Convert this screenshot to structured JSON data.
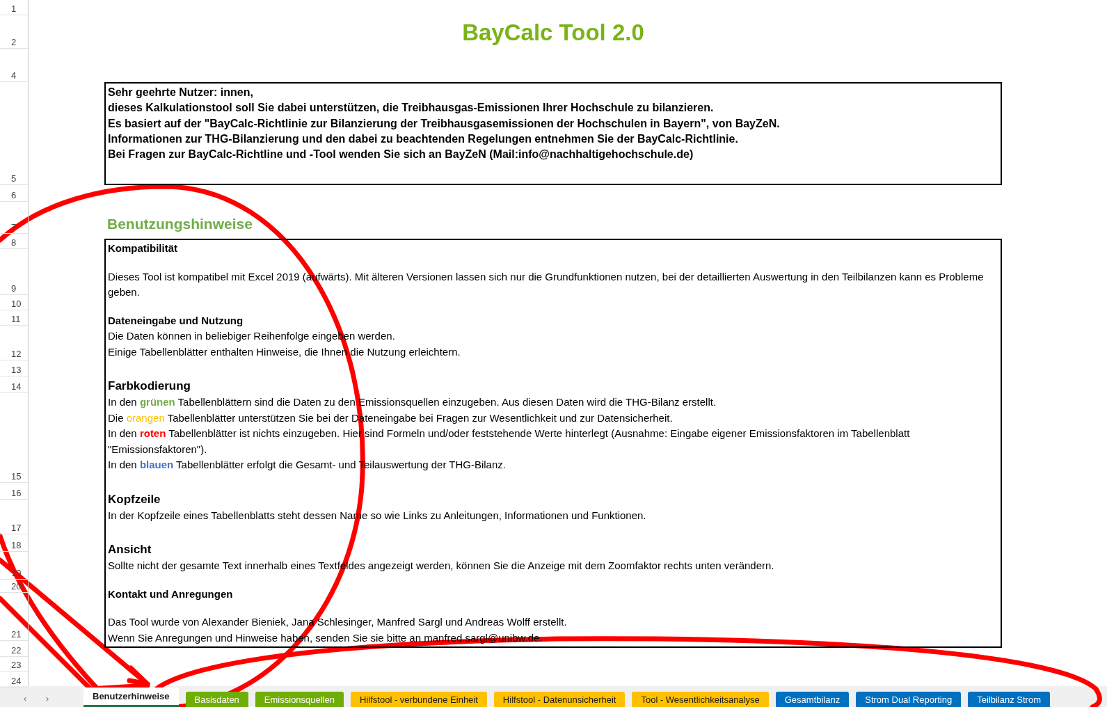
{
  "row_headers": [
    "1",
    "2",
    "4",
    "5",
    "6",
    "7",
    "8",
    "9",
    "10",
    "11",
    "12",
    "13",
    "14",
    "15",
    "16",
    "17",
    "18",
    "19",
    "20",
    "21",
    "22",
    "23",
    "24"
  ],
  "title": "BayCalc Tool 2.0",
  "intro": [
    "Sehr geehrte Nutzer: innen,",
    "dieses Kalkulationstool soll Sie dabei unterstützen, die Treibhausgas-Emissionen Ihrer Hochschule zu bilanzieren.",
    "Es basiert auf der \"BayCalc-Richtlinie zur Bilanzierung der Treibhausgasemissionen der Hochschulen in Bayern\", von BayZeN.",
    "Informationen zur THG-Bilanzierung und den dabei zu beachtenden Regelungen entnehmen Sie der BayCalc-Richtlinie.",
    "Bei Fragen zur BayCalc-Richtline und -Tool wenden Sie sich an BayZeN (Mail:info@nachhaltigehochschule.de)"
  ],
  "section_heading": "Benutzungshinweise",
  "notes": [
    {
      "kind": "heading",
      "text": "Kompatibilität"
    },
    {
      "kind": "blank"
    },
    {
      "kind": "text",
      "text": "Dieses Tool ist kompatibel mit Excel 2019 (aufwärts). Mit älteren Versionen lassen sich nur die Grundfunktionen nutzen, bei der detaillierten Auswertung in den Teilbilanzen kann es Probleme geben."
    },
    {
      "kind": "blank"
    },
    {
      "kind": "heading",
      "text": "Dateneingabe und Nutzung"
    },
    {
      "kind": "text",
      "text": "Die Daten können in beliebiger Reihenfolge eingeben werden."
    },
    {
      "kind": "text",
      "text": "Einige Tabellenblätter enthalten Hinweise, die Ihnen die Nutzung erleichtern."
    },
    {
      "kind": "blank"
    },
    {
      "kind": "large-heading",
      "text": "Farbkodierung"
    },
    {
      "kind": "colored",
      "before": "In den ",
      "word": "grünen",
      "after": " Tabellenblättern sind die Daten zu den Emissionsquellen einzugeben. Aus diesen Daten wird die THG-Bilanz erstellt.",
      "color": "#70ad47",
      "bold": true
    },
    {
      "kind": "colored",
      "before": "Die ",
      "word": "orangen",
      "after": " Tabellenblätter unterstützen Sie bei der Dateneingabe bei Fragen zur Wesentlichkeit und zur Datensicherheit.",
      "color": "#ffc000",
      "bold": false
    },
    {
      "kind": "colored",
      "before": "In den ",
      "word": "roten",
      "after": " Tabellenblätter ist nichts einzugeben. Hier sind Formeln und/oder feststehende Werte hinterlegt (Ausnahme: Eingabe eigener Emissionsfaktoren im Tabellenblatt \"Emissionsfaktoren\").",
      "color": "#ff0000",
      "bold": true
    },
    {
      "kind": "colored",
      "before": "In den ",
      "word": "blauen",
      "after": " Tabellenblätter erfolgt die Gesamt- und Teilauswertung der THG-Bilanz.",
      "color": "#4472c4",
      "bold": true
    },
    {
      "kind": "blank"
    },
    {
      "kind": "large-heading",
      "text": "Kopfzeile"
    },
    {
      "kind": "text",
      "text": "In der Kopfzeile eines Tabellenblatts steht dessen Name so wie Links zu Anleitungen, Informationen und Funktionen."
    },
    {
      "kind": "blank"
    },
    {
      "kind": "large-heading",
      "text": "Ansicht"
    },
    {
      "kind": "text",
      "text": "Sollte nicht der gesamte Text innerhalb eines Textfeldes angezeigt werden, können Sie die Anzeige mit dem Zoomfaktor rechts unten verändern."
    },
    {
      "kind": "blank"
    },
    {
      "kind": "heading",
      "text": "Kontakt und Anregungen"
    },
    {
      "kind": "blank"
    },
    {
      "kind": "text",
      "text": "Das Tool wurde von Alexander Bieniek, Jana Schlesinger, Manfred Sargl und Andreas Wolff erstellt."
    },
    {
      "kind": "text",
      "text": "Wenn Sie Anregungen und Hinweise haben, senden Sie sie bitte an manfred.sargl@unibw.de."
    }
  ],
  "sheet_nav": [
    "‹",
    "›"
  ],
  "sheet_tabs": [
    {
      "label": "Benutzerhinweise",
      "selected": true,
      "color": "#ffffff"
    },
    {
      "label": "Basisdaten",
      "selected": false,
      "color": "#70ad07"
    },
    {
      "label": "Emissionsquellen",
      "selected": false,
      "color": "#70ad07"
    },
    {
      "label": "Hilfstool - verbundene Einheit",
      "selected": false,
      "color": "#ffc000"
    },
    {
      "label": "Hilfstool - Datenunsicherheit",
      "selected": false,
      "color": "#ffc000"
    },
    {
      "label": "Tool - Wesentlichkeitsanalyse",
      "selected": false,
      "color": "#ffc000"
    },
    {
      "label": "Gesamtbilanz",
      "selected": false,
      "color": "#0070c0"
    },
    {
      "label": "Strom Dual Reporting",
      "selected": false,
      "color": "#0070c0"
    },
    {
      "label": "Teilbilanz Strom",
      "selected": false,
      "color": "#0070c0"
    }
  ]
}
